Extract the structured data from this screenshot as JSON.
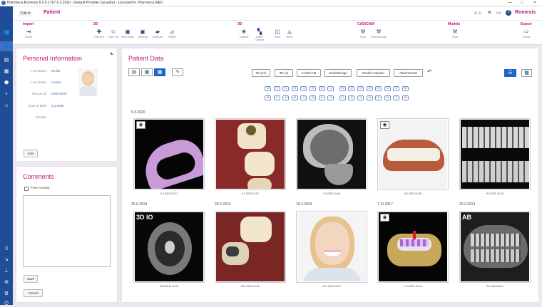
{
  "window": {
    "title": "Planmeca Romexis 6.0.0.1767 6.3.2020 - Default Provider (sysadm) - Licensed to: Planmeca R&D",
    "controls": [
      "—",
      "□",
      "×"
    ]
  },
  "topbar": {
    "menu_label": "File",
    "section_title": "Patient",
    "user": "A. E.",
    "brand": "Romexis"
  },
  "toolbar": {
    "groups": {
      "import": "Import",
      "twod": "2D",
      "threed": "3D",
      "cadcam": "CAD/CAM",
      "models": "Models",
      "export": "Export"
    },
    "buttons": {
      "import": "Import",
      "pan_exp": "Pan Exp",
      "ceph_exp": "Ceph Exp",
      "intra_study": "Intra Study",
      "intra_exp": "Intra Exp",
      "intracam": "IntraCam",
      "twain": "TWAIN",
      "capture": "Capture",
      "model_capture": "Model Capture",
      "ara": "ARA",
      "ortho": "Ortho",
      "scan": "Scan",
      "scan_design": "Scan&Design",
      "models_scan": "Scan",
      "export": "Export"
    }
  },
  "personal_info": {
    "title": "Personal Information",
    "fields": [
      {
        "label": "First Name",
        "value": "Emilia"
      },
      {
        "label": "Last Name",
        "value": "Austen"
      },
      {
        "label": "Person ID",
        "value": "0000-0000"
      },
      {
        "label": "Date of Birth",
        "value": "2.2.1986"
      },
      {
        "label": "Gender",
        "value": ""
      }
    ],
    "edit_label": "Edit"
  },
  "comments": {
    "title": "Comments",
    "free_access_label": "Free Access",
    "save_label": "Save",
    "cancel_label": "Cancel"
  },
  "patient_data": {
    "title": "Patient Data",
    "filters": [
      "2D (27)",
      "3D (1)",
      "CAD/CAM",
      "SmileDesign",
      "Model Analyser",
      "Attachments"
    ],
    "teeth_row1": [
      "18",
      "17",
      "16",
      "15",
      "14",
      "13",
      "12",
      "11",
      "21",
      "22",
      "23",
      "24",
      "25",
      "26",
      "27",
      "28"
    ],
    "teeth_row2": [
      "48",
      "47",
      "46",
      "45",
      "44",
      "43",
      "42",
      "41",
      "31",
      "32",
      "33",
      "34",
      "35",
      "36",
      "37",
      "38"
    ],
    "sections": [
      {
        "date": "9.3.2020",
        "items": [
          {
            "caption": "9.3.2020 22:01",
            "kind": "model",
            "badge": "camera"
          },
          {
            "caption": "9.3.2020 21:57",
            "kind": "intraoral",
            "badge": ""
          },
          {
            "caption": "9.3.2020 21:56",
            "kind": "ceph",
            "badge": ""
          },
          {
            "caption": "9.3.2020 21:55",
            "kind": "teeth",
            "badge": "camera"
          },
          {
            "caption": "9.3.2020 12:15",
            "kind": "bitewing",
            "badge": ""
          }
        ]
      },
      {
        "items": [
          {
            "date": "26.6.2019",
            "caption": "26.6.2019 11:03",
            "kind": "ct",
            "badge": "3D IO"
          },
          {
            "date": "20.2.2019",
            "caption": "20.2.2019 11:22",
            "kind": "intraoral",
            "badge": ""
          },
          {
            "date": "19.2.2019",
            "caption": "19.2.2019 10:27",
            "kind": "portrait",
            "badge": ""
          },
          {
            "date": "7.11.2017",
            "caption": "7.11.2017 11:44",
            "kind": "render3d",
            "badge": "camera"
          },
          {
            "date": "22.2.2013",
            "caption": "22.2.2013 8:47",
            "kind": "pano",
            "badge": "AB"
          }
        ]
      }
    ]
  },
  "colors": {
    "accent": "#c2187a",
    "nav": "#1f4e97",
    "link": "#3f6fb5"
  }
}
